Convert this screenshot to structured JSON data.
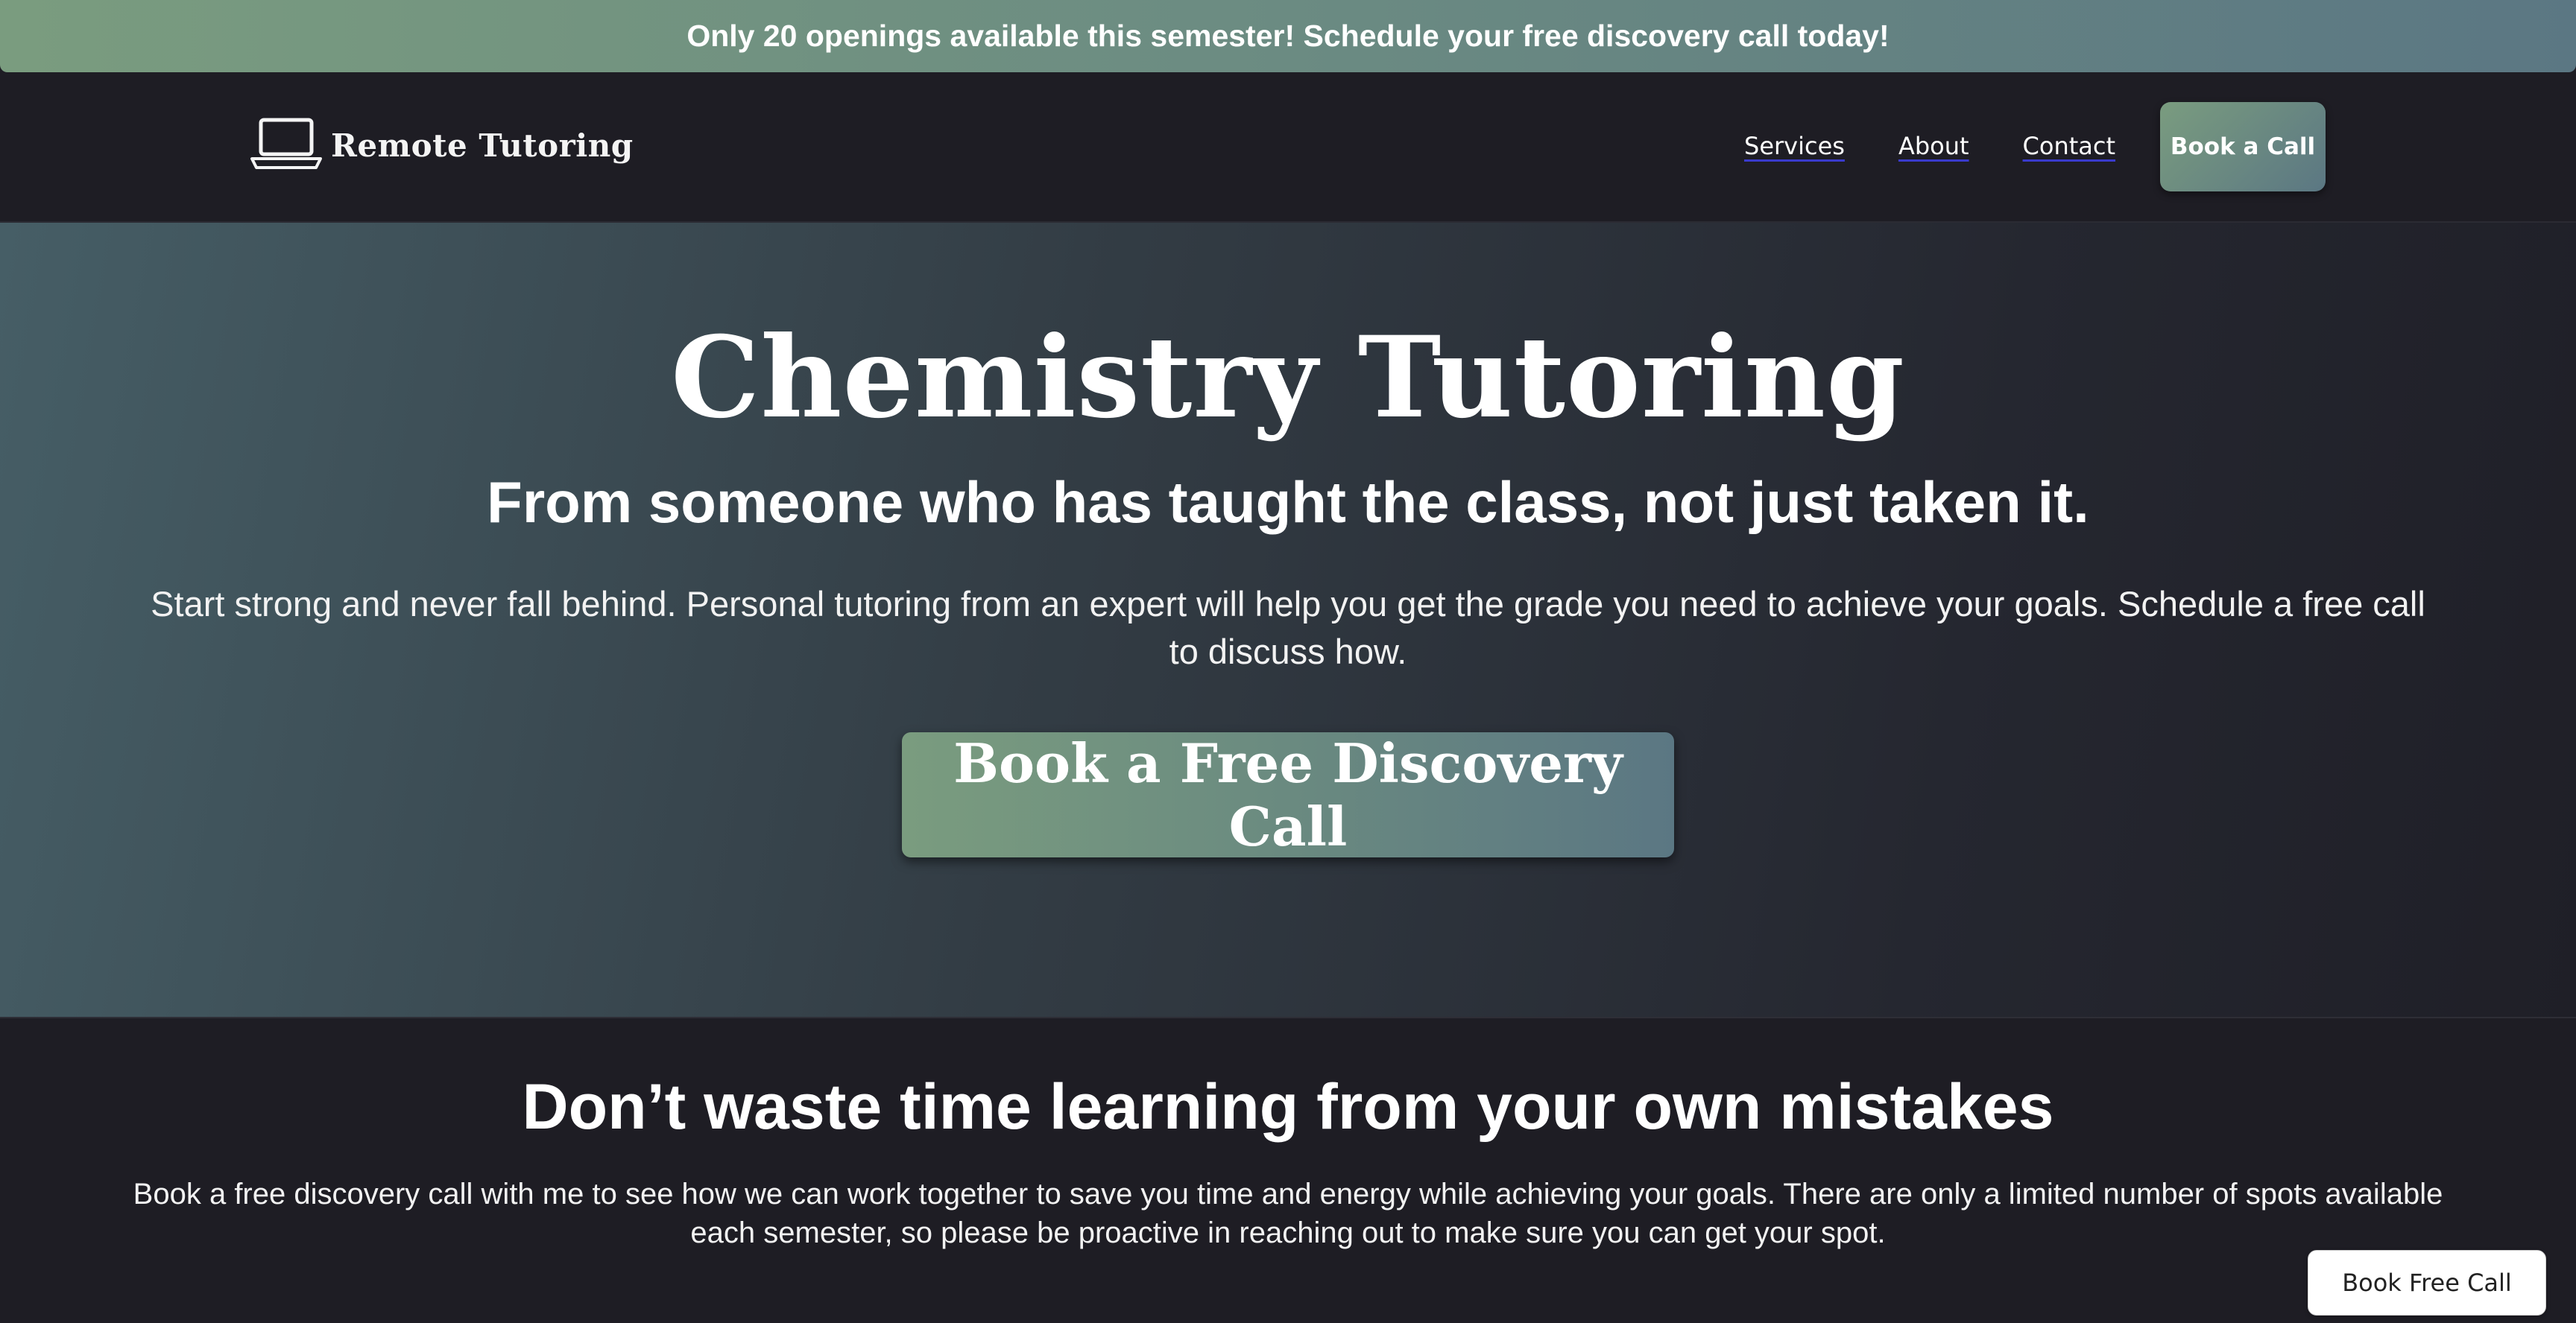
{
  "banner": {
    "text": "Only 20 openings available this semester! Schedule your free discovery call today!"
  },
  "header": {
    "logo_text": "Remote Tutoring",
    "logo_icon": "laptop-icon",
    "nav": [
      "Services",
      "About",
      "Contact"
    ],
    "cta_label": "Book a Call"
  },
  "hero": {
    "title": "Chemistry Tutoring",
    "subtitle": "From someone who has taught the class, not just taken it.",
    "body": "Start strong and never fall behind. Personal tutoring from an expert will help you get the grade you need to achieve your goals. Schedule a free call to discuss how.",
    "cta_label": "Book a Free Discovery Call"
  },
  "section": {
    "title": "Don’t waste time learning from your own mistakes",
    "body": "Book a free discovery call with me to see how we can work together to save you time and energy while achieving your goals.  There are only a limited number of spots available each semester, so please be proactive in reaching out to make sure you can get your spot."
  },
  "floating_cta": {
    "label": "Book Free Call"
  },
  "colors": {
    "accent_start": "#7a9c7f",
    "accent_end": "#5b7783",
    "background": "#1e1d24",
    "nav_underline": "#3a3acc"
  }
}
